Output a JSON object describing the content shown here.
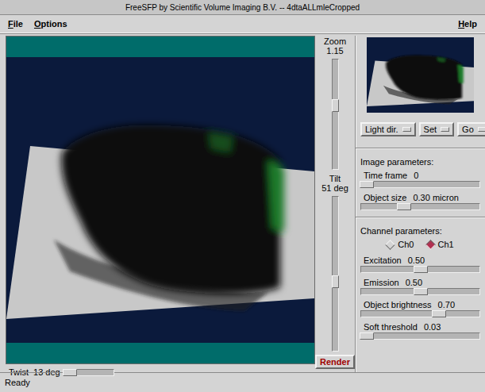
{
  "window": {
    "title": "FreeSFP by Scientific Volume Imaging B.V. -- 4dtaALLmleCropped"
  },
  "menu": {
    "left": [
      "File",
      "Options"
    ],
    "right": [
      "Help"
    ]
  },
  "view_controls": {
    "zoom": {
      "label": "Zoom",
      "value": "1.15",
      "level": 0.58
    },
    "tilt": {
      "label": "Tilt",
      "value": "51 deg",
      "level": 0.45
    },
    "twist": {
      "label": "Twist",
      "value": "13 deg",
      "level": 0.08
    }
  },
  "render_button": "Render",
  "light_buttons": [
    "Light dir.",
    "Set",
    "Go"
  ],
  "image_parameters": {
    "title": "Image parameters:",
    "sliders": [
      {
        "label": "Time frame",
        "value": "0",
        "level": 0.05
      },
      {
        "label": "Object size",
        "value": "0.30 micron",
        "level": 0.36
      }
    ]
  },
  "channel_parameters": {
    "title": "Channel parameters:",
    "channels": [
      {
        "label": "Ch0",
        "selected": false
      },
      {
        "label": "Ch1",
        "selected": true
      }
    ],
    "sliders": [
      {
        "label": "Excitation",
        "value": "0.50",
        "level": 0.5
      },
      {
        "label": "Emission",
        "value": "0.50",
        "level": 0.5
      },
      {
        "label": "Object brightness",
        "value": "0.70",
        "level": 0.66
      },
      {
        "label": "Soft threshold",
        "value": "0.03",
        "level": 0.05
      }
    ]
  },
  "status_bar": "Ready"
}
